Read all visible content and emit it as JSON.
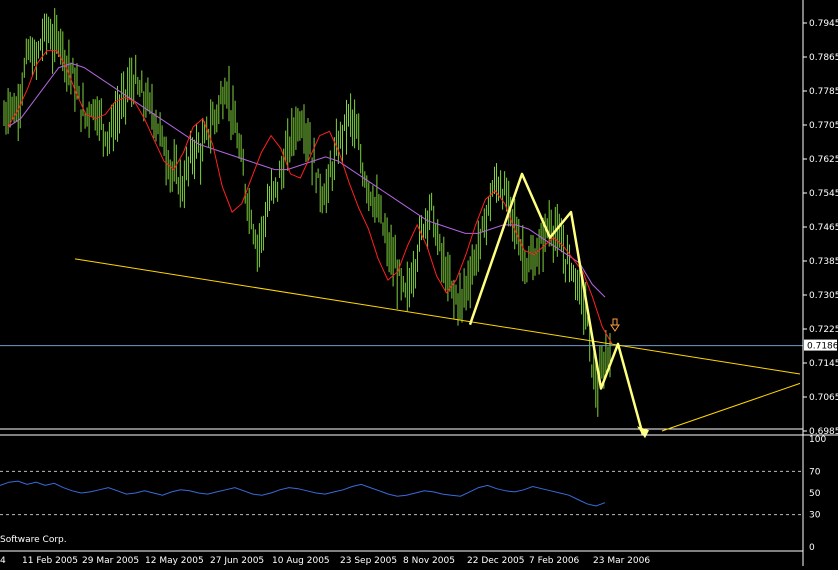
{
  "chart_data": [
    {
      "type": "candlestick",
      "title": "",
      "y_axis_side": "right",
      "ylim": [
        0.6985,
        0.7985
      ],
      "y_ticks": [
        "0.7945",
        "0.7865",
        "0.7785",
        "0.7705",
        "0.7625",
        "0.7545",
        "0.7465",
        "0.7385",
        "0.7305",
        "0.7225",
        "0.7145",
        "0.7065",
        "0.6985"
      ],
      "current_price": "0.7186",
      "x_ticks": [
        "4",
        "11 Feb 2005",
        "29 Mar 2005",
        "12 May 2005",
        "27 Jun 2005",
        "10 Aug 2005",
        "23 Sep 2005",
        "8 Nov 2005",
        "22 Dec 2005",
        "7 Feb 2006",
        "23 Mar 2006"
      ],
      "colors": {
        "bars": "#7FD13B",
        "ma_fast": "#FF2020",
        "ma_slow": "#B266E0",
        "trendline": "#FFD700",
        "pattern": "#FFFF80",
        "rsi": "#3A6BDA",
        "hline": "#6E9EC8"
      },
      "price_path": [
        0.772,
        0.776,
        0.773,
        0.781,
        0.788,
        0.785,
        0.79,
        0.7935,
        0.789,
        0.792,
        0.786,
        0.783,
        0.777,
        0.772,
        0.775,
        0.774,
        0.77,
        0.768,
        0.772,
        0.775,
        0.779,
        0.781,
        0.778,
        0.776,
        0.774,
        0.77,
        0.765,
        0.76,
        0.758,
        0.756,
        0.762,
        0.766,
        0.764,
        0.769,
        0.772,
        0.776,
        0.78,
        0.772,
        0.765,
        0.756,
        0.749,
        0.742,
        0.747,
        0.753,
        0.756,
        0.76,
        0.765,
        0.77,
        0.772,
        0.769,
        0.762,
        0.756,
        0.754,
        0.76,
        0.765,
        0.77,
        0.773,
        0.768,
        0.76,
        0.756,
        0.752,
        0.748,
        0.742,
        0.738,
        0.734,
        0.73,
        0.735,
        0.742,
        0.748,
        0.752,
        0.744,
        0.738,
        0.733,
        0.73,
        0.729,
        0.734,
        0.738,
        0.743,
        0.749,
        0.755,
        0.757,
        0.754,
        0.75,
        0.745,
        0.74,
        0.737,
        0.739,
        0.743,
        0.747,
        0.746,
        0.742,
        0.739,
        0.737,
        0.732,
        0.728,
        0.715,
        0.708,
        0.714,
        0.719
      ],
      "ma_fast": [
        0.77,
        0.774,
        0.779,
        0.785,
        0.788,
        0.788,
        0.784,
        0.778,
        0.773,
        0.772,
        0.773,
        0.776,
        0.777,
        0.776,
        0.772,
        0.767,
        0.762,
        0.76,
        0.764,
        0.77,
        0.772,
        0.766,
        0.756,
        0.75,
        0.752,
        0.758,
        0.764,
        0.768,
        0.765,
        0.759,
        0.758,
        0.763,
        0.768,
        0.769,
        0.764,
        0.757,
        0.751,
        0.746,
        0.739,
        0.734,
        0.736,
        0.742,
        0.747,
        0.742,
        0.735,
        0.731,
        0.734,
        0.74,
        0.747,
        0.753,
        0.755,
        0.752,
        0.746,
        0.741,
        0.74,
        0.742,
        0.744,
        0.742,
        0.739,
        0.736,
        0.73,
        0.723,
        0.719
      ],
      "ma_slow": [
        0.77,
        0.772,
        0.776,
        0.78,
        0.784,
        0.785,
        0.784,
        0.782,
        0.78,
        0.778,
        0.776,
        0.774,
        0.772,
        0.77,
        0.768,
        0.766,
        0.765,
        0.764,
        0.763,
        0.762,
        0.761,
        0.76,
        0.76,
        0.761,
        0.762,
        0.763,
        0.762,
        0.76,
        0.758,
        0.756,
        0.754,
        0.752,
        0.75,
        0.748,
        0.747,
        0.746,
        0.745,
        0.745,
        0.746,
        0.747,
        0.747,
        0.746,
        0.744,
        0.742,
        0.74,
        0.738,
        0.733,
        0.73
      ],
      "trendline": [
        {
          "date_index": 0.09,
          "price": 0.739
        },
        {
          "date_index": 1.0,
          "price": 0.7115
        }
      ],
      "pattern_points": [
        0.7235,
        0.759,
        0.744,
        0.75,
        0.7085,
        0.719,
        0.6975
      ],
      "rsi_panel": {
        "ylim": [
          0,
          100
        ],
        "y_ticks": [
          "100",
          "70",
          "50",
          "30",
          "0"
        ],
        "levels": [
          70,
          30
        ],
        "values": [
          57,
          60,
          61,
          58,
          60,
          57,
          59,
          55,
          52,
          50,
          51,
          53,
          55,
          52,
          49,
          50,
          52,
          50,
          48,
          51,
          53,
          52,
          50,
          49,
          51,
          53,
          55,
          52,
          49,
          48,
          50,
          53,
          55,
          54,
          52,
          50,
          49,
          51,
          53,
          56,
          58,
          55,
          52,
          49,
          47,
          48,
          50,
          52,
          51,
          49,
          48,
          47,
          51,
          55,
          57,
          54,
          52,
          51,
          53,
          56,
          54,
          52,
          50,
          48,
          44,
          40,
          38,
          41
        ]
      },
      "watermark": "Software Corp."
    }
  ]
}
